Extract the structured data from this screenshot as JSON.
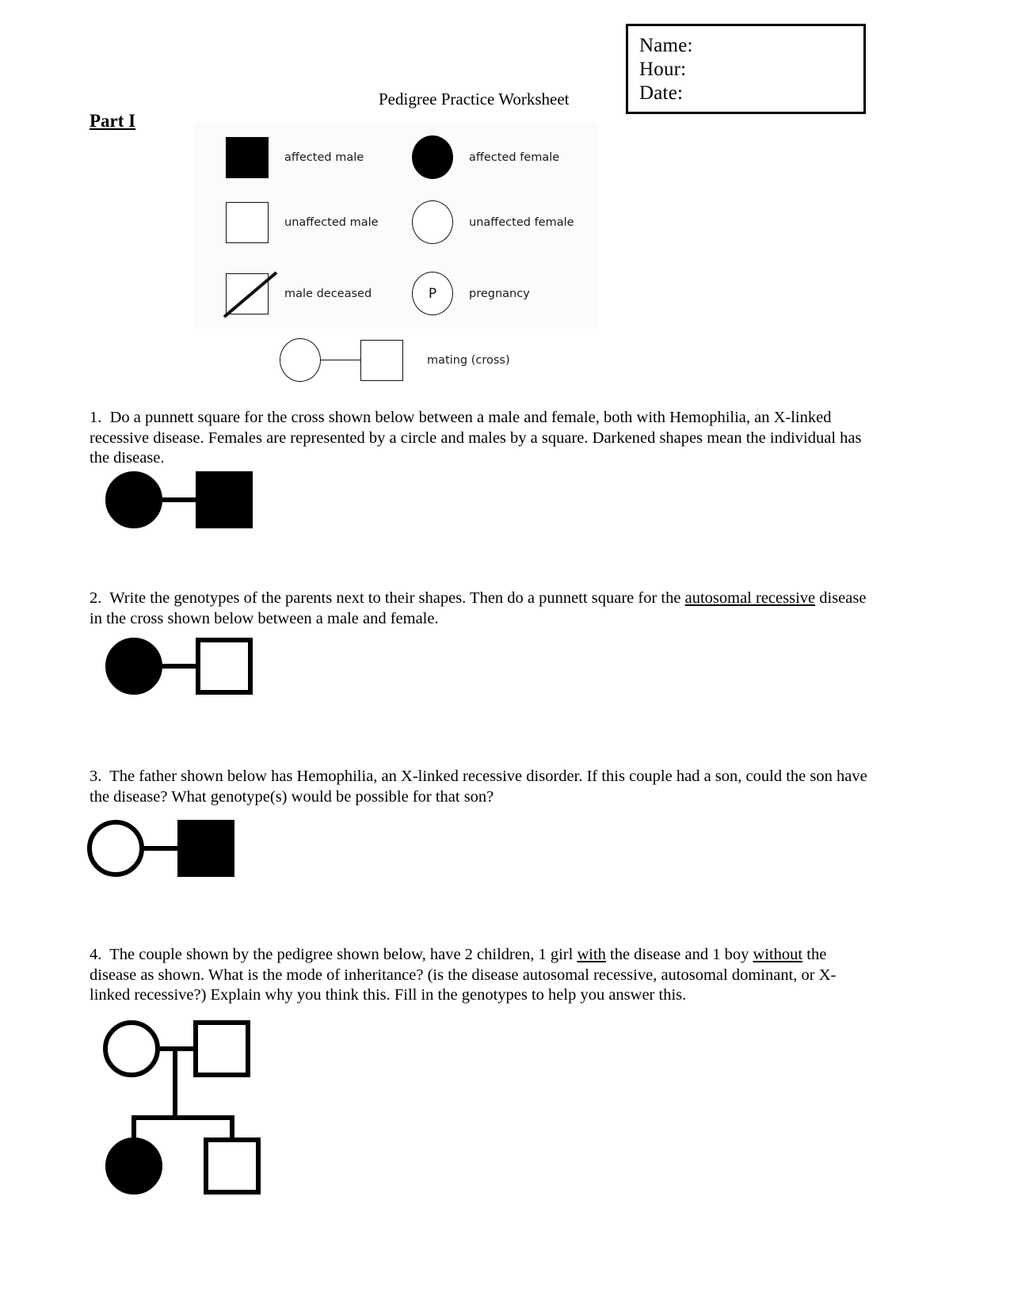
{
  "header": {
    "title": "Pedigree Practice Worksheet",
    "part_label": "Part I",
    "name_box": {
      "name": "Name:",
      "hour": "Hour:",
      "date": "Date:"
    }
  },
  "legend": {
    "affected_male": "affected male",
    "affected_female": "affected female",
    "unaffected_male": "unaffected male",
    "unaffected_female": "unaffected female",
    "male_deceased": "male deceased",
    "pregnancy": "pregnancy",
    "pregnancy_symbol": "P",
    "mating_cross": "mating (cross)"
  },
  "questions": [
    {
      "number": "1.",
      "text_part_1": "Do a punnett square for the cross shown below between a male and female, both with Hemophilia, an X-linked recessive disease.  Females are represented by a circle and males by a square.  Darkened shapes mean the individual has the disease.",
      "pedigree": {
        "female": "affected",
        "male": "affected"
      }
    },
    {
      "number": "2.",
      "text_part_1": "Write the genotypes of the parents next to their shapes.  Then do a punnett square for the ",
      "underlined": "autosomal recessive",
      "text_part_2": " disease in the cross shown below between a male and female.",
      "pedigree": {
        "female": "affected",
        "male": "unaffected"
      }
    },
    {
      "number": "3.",
      "text_part_1": "The father shown below has Hemophilia, an X-linked recessive disorder.  If this couple had a son, could the son have the disease?  What genotype(s) would be possible for that son?",
      "pedigree": {
        "female": "unaffected",
        "male": "affected"
      }
    },
    {
      "number": "4.",
      "text_part_1": "The couple shown by the pedigree shown below, have 2 children, 1 girl ",
      "underlined_1": "with",
      "text_part_2": " the disease and 1 boy ",
      "underlined_2": "without",
      "text_part_3": " the disease as shown.  What is the mode of inheritance? (is the disease autosomal recessive, autosomal dominant, or X-linked recessive?)  Explain why you think this.  Fill in the genotypes to help you answer this.",
      "pedigree": {
        "mother": "unaffected",
        "father": "unaffected",
        "daughter": "affected",
        "son": "unaffected"
      }
    }
  ],
  "colors": {
    "ink": "#000000",
    "paper": "#ffffff",
    "legend_bg": "#fbfbfb"
  }
}
